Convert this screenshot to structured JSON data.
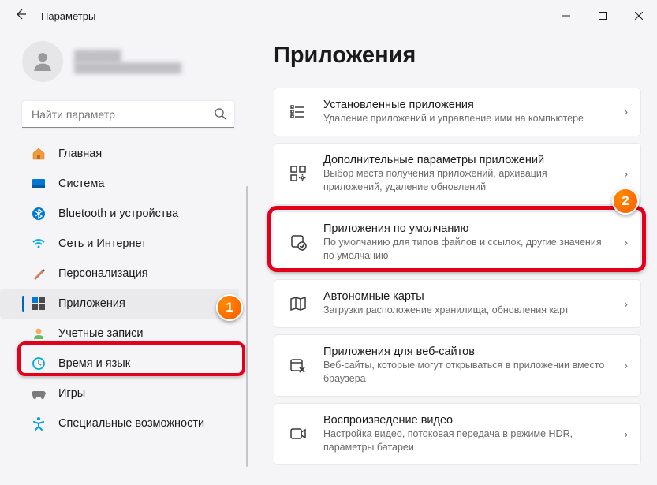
{
  "titlebar": {
    "title": "Параметры"
  },
  "profile": {
    "name": "██████",
    "email": "████████████████"
  },
  "search": {
    "placeholder": "Найти параметр"
  },
  "nav": {
    "items": [
      {
        "label": "Главная"
      },
      {
        "label": "Система"
      },
      {
        "label": "Bluetooth и устройства"
      },
      {
        "label": "Сеть и Интернет"
      },
      {
        "label": "Персонализация"
      },
      {
        "label": "Приложения"
      },
      {
        "label": "Учетные записи"
      },
      {
        "label": "Время и язык"
      },
      {
        "label": "Игры"
      },
      {
        "label": "Специальные возможности"
      }
    ]
  },
  "page": {
    "title": "Приложения"
  },
  "cards": [
    {
      "title": "Установленные приложения",
      "sub": "Удаление приложений и управление ими на компьютере"
    },
    {
      "title": "Дополнительные параметры приложений",
      "sub": "Выбор места получения приложений, архивация приложений, удаление обновлений"
    },
    {
      "title": "Приложения по умолчанию",
      "sub": "По умолчанию для типов файлов и ссылок, другие значения по умолчанию"
    },
    {
      "title": "Автономные карты",
      "sub": "Загрузки расположение хранилища, обновления карт"
    },
    {
      "title": "Приложения для веб-сайтов",
      "sub": "Веб-сайты, которые могут открываться в приложении вместо браузера"
    },
    {
      "title": "Воспроизведение видео",
      "sub": "Настройка видео, потоковая передача в режиме HDR, параметры батареи"
    }
  ],
  "markers": {
    "one": "1",
    "two": "2"
  }
}
